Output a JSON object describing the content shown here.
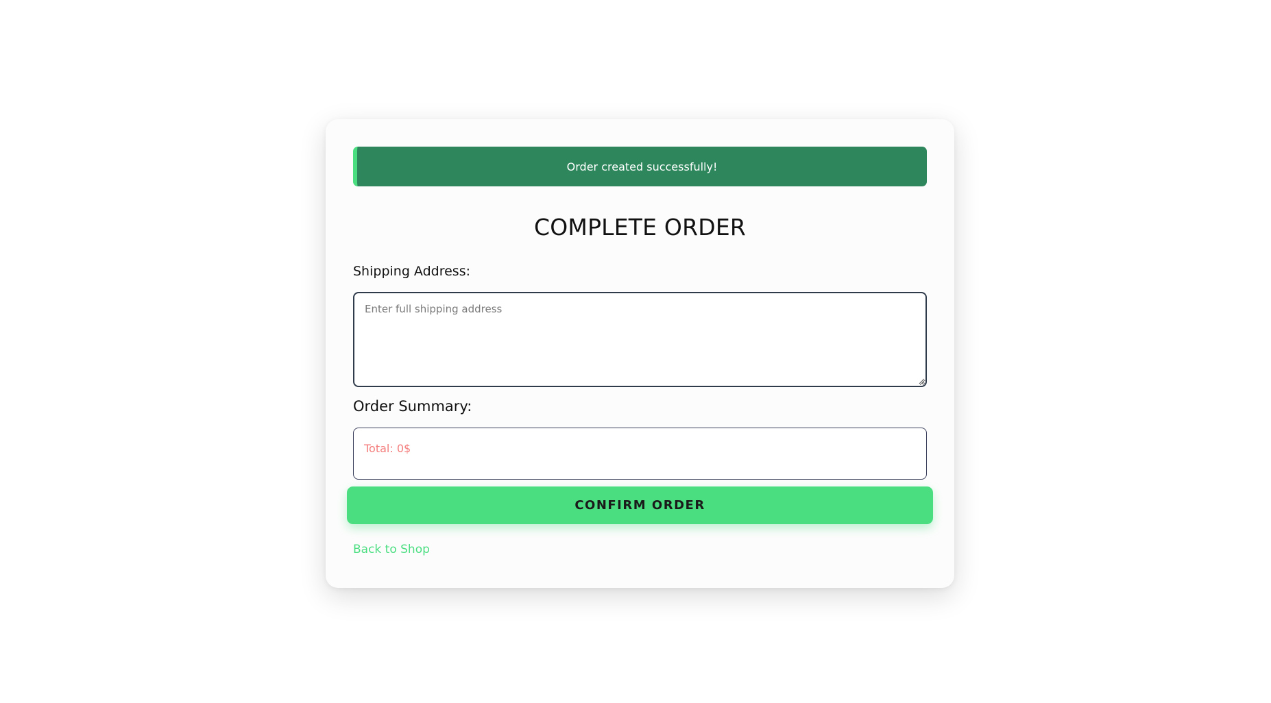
{
  "alert": {
    "message": "Order created successfully!",
    "color": "#2e875c",
    "accent": "#4ade80"
  },
  "page_title": "COMPLETE ORDER",
  "shipping": {
    "label": "Shipping Address:",
    "placeholder": "Enter full shipping address",
    "value": ""
  },
  "summary": {
    "label": "Order Summary:",
    "total_text": "Total: 0$",
    "total_color": "#f47c7c"
  },
  "actions": {
    "confirm_label": "CONFIRM ORDER",
    "confirm_color": "#4ade80",
    "back_label": "Back to Shop"
  }
}
